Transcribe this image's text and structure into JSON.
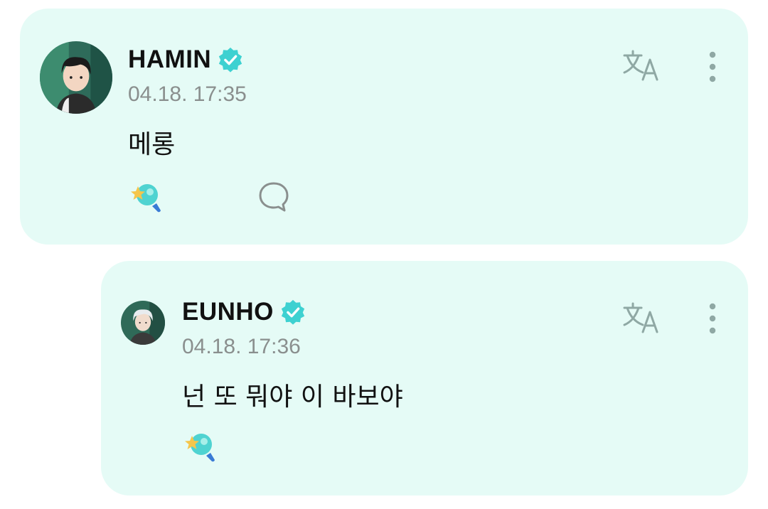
{
  "colors": {
    "card_bg": "#e5fbf6",
    "verified": "#3ed1d1",
    "icon_gray": "#8fa8a4",
    "timestamp": "#8a8f8e"
  },
  "posts": [
    {
      "author": "HAMIN",
      "verified": true,
      "timestamp": "04.18. 17:35",
      "text": "메롱",
      "icons": [
        "avatar",
        "verified-badge-icon",
        "translate-icon",
        "more-vertical-icon",
        "reaction-icon",
        "comment-icon"
      ]
    },
    {
      "author": "EUNHO",
      "verified": true,
      "timestamp": "04.18. 17:36",
      "text": "넌 또 뭐야 이 바보야",
      "icons": [
        "avatar",
        "verified-badge-icon",
        "translate-icon",
        "more-vertical-icon",
        "reaction-icon"
      ]
    }
  ]
}
